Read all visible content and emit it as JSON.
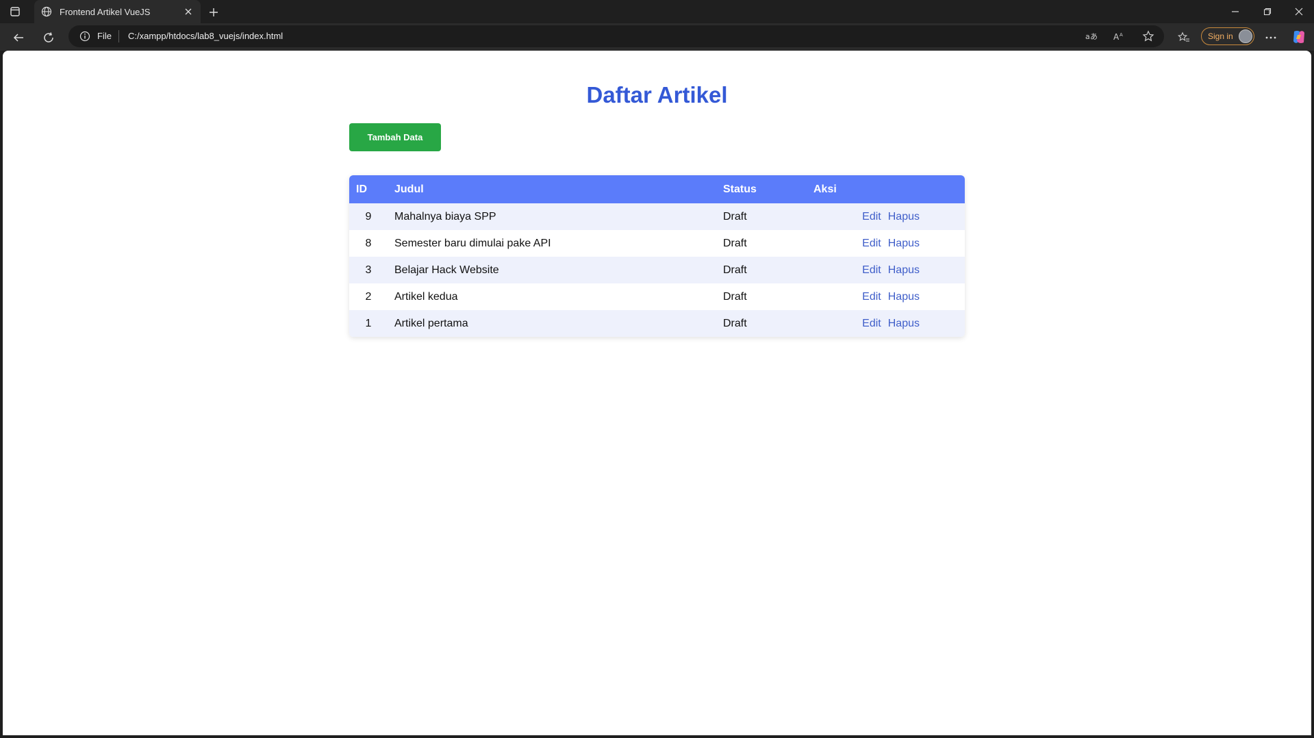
{
  "browser": {
    "tab_title": "Frontend Artikel VueJS",
    "address_scheme": "File",
    "address_url": "C:/xampp/htdocs/lab8_vuejs/index.html",
    "signin_label": "Sign in"
  },
  "page": {
    "title": "Daftar Artikel",
    "add_button_label": "Tambah Data",
    "table": {
      "headers": {
        "id": "ID",
        "judul": "Judul",
        "status": "Status",
        "aksi": "Aksi"
      },
      "rows": [
        {
          "id": "9",
          "judul": "Mahalnya biaya SPP",
          "status": "Draft",
          "edit": "Edit",
          "hapus": "Hapus"
        },
        {
          "id": "8",
          "judul": "Semester baru dimulai pake API",
          "status": "Draft",
          "edit": "Edit",
          "hapus": "Hapus"
        },
        {
          "id": "3",
          "judul": "Belajar Hack Website",
          "status": "Draft",
          "edit": "Edit",
          "hapus": "Hapus"
        },
        {
          "id": "2",
          "judul": "Artikel kedua",
          "status": "Draft",
          "edit": "Edit",
          "hapus": "Hapus"
        },
        {
          "id": "1",
          "judul": "Artikel pertama",
          "status": "Draft",
          "edit": "Edit",
          "hapus": "Hapus"
        }
      ]
    }
  },
  "colors": {
    "title": "#3459d6",
    "add_button": "#28a745",
    "table_header": "#5b7cfa",
    "row_stripe": "#eef1fc",
    "link": "#3f5ec9"
  }
}
